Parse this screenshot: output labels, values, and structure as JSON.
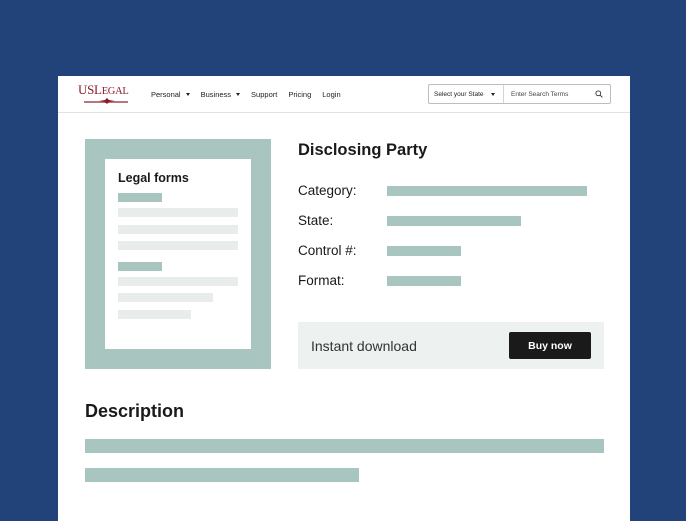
{
  "header": {
    "logo": {
      "text_us": "US",
      "text_legal_initial": "L",
      "text_legal_rest": "EGAL"
    },
    "nav": [
      {
        "label": "Personal",
        "dropdown": true
      },
      {
        "label": "Business",
        "dropdown": true
      },
      {
        "label": "Support",
        "dropdown": false
      },
      {
        "label": "Pricing",
        "dropdown": false
      },
      {
        "label": "Login",
        "dropdown": false
      }
    ],
    "search": {
      "state_select_label": "Select your State",
      "placeholder": "Enter Search Terms",
      "icon": "search-icon"
    }
  },
  "preview": {
    "title": "Legal forms"
  },
  "document": {
    "title": "Disclosing Party",
    "fields": [
      {
        "label": "Category:"
      },
      {
        "label": "State:"
      },
      {
        "label": "Control #:"
      },
      {
        "label": "Format:"
      }
    ]
  },
  "download": {
    "text": "Instant download",
    "button_label": "Buy now"
  },
  "description": {
    "title": "Description"
  },
  "colors": {
    "background": "#22427a",
    "placeholder_bar": "#a8c5c0",
    "light_bar": "#e8edec",
    "brand": "#8b1a2b",
    "button": "#1a1a1a"
  }
}
